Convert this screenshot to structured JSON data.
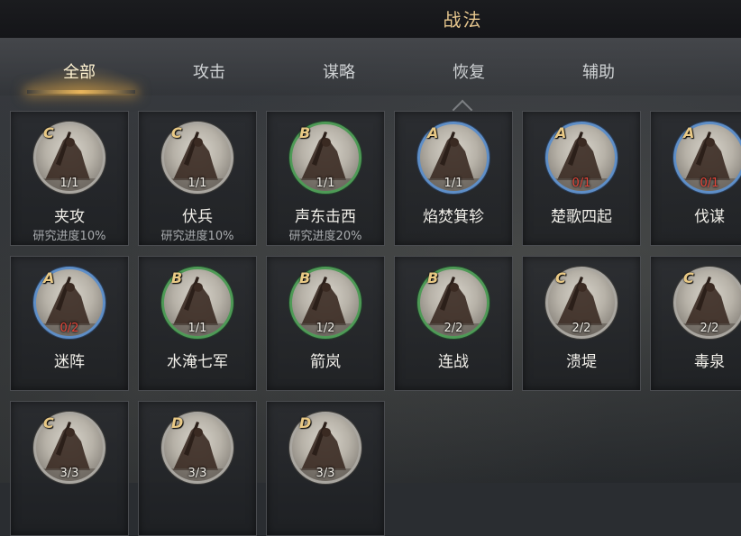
{
  "header": {
    "title": "战法"
  },
  "tabs": [
    {
      "label": "全部",
      "active": true
    },
    {
      "label": "攻击",
      "active": false
    },
    {
      "label": "谋略",
      "active": false
    },
    {
      "label": "恢复",
      "active": false
    },
    {
      "label": "辅助",
      "active": false
    }
  ],
  "colors": {
    "accent_gold": "#e7c78e",
    "grade_A_ring": "#5e8ec7",
    "grade_B_ring": "#4e9a56",
    "grade_C_ring": "#a9a6a0",
    "count_short": "#e4463a"
  },
  "skills": [
    {
      "grade": "C",
      "count": "1/1",
      "name": "夹攻",
      "progress": "研究进度10%",
      "short": false
    },
    {
      "grade": "C",
      "count": "1/1",
      "name": "伏兵",
      "progress": "研究进度10%",
      "short": false
    },
    {
      "grade": "B",
      "count": "1/1",
      "name": "声东击西",
      "progress": "研究进度20%",
      "short": false
    },
    {
      "grade": "A",
      "count": "1/1",
      "name": "焰焚箕轸",
      "progress": "",
      "short": false
    },
    {
      "grade": "A",
      "count": "0/1",
      "name": "楚歌四起",
      "progress": "",
      "short": true
    },
    {
      "grade": "A",
      "count": "0/1",
      "name": "伐谋",
      "progress": "",
      "short": true
    },
    {
      "grade": "A",
      "count": "0/2",
      "name": "迷阵",
      "progress": "",
      "short": true
    },
    {
      "grade": "B",
      "count": "1/1",
      "name": "水淹七军",
      "progress": "",
      "short": false
    },
    {
      "grade": "B",
      "count": "1/2",
      "name": "箭岚",
      "progress": "",
      "short": false
    },
    {
      "grade": "B",
      "count": "2/2",
      "name": "连战",
      "progress": "",
      "short": false
    },
    {
      "grade": "C",
      "count": "2/2",
      "name": "溃堤",
      "progress": "",
      "short": false
    },
    {
      "grade": "C",
      "count": "2/2",
      "name": "毒泉",
      "progress": "",
      "short": false
    },
    {
      "grade": "C",
      "count": "3/3",
      "name": "",
      "progress": "",
      "short": false
    },
    {
      "grade": "D",
      "count": "3/3",
      "name": "",
      "progress": "",
      "short": false
    },
    {
      "grade": "D",
      "count": "3/3",
      "name": "",
      "progress": "",
      "short": false
    }
  ]
}
